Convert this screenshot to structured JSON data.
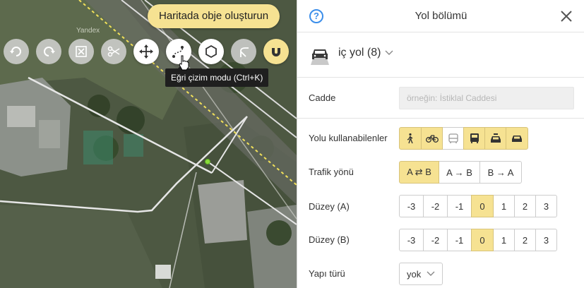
{
  "map": {
    "create_button": "Haritada obje oluşturun",
    "watermark": "Yandex",
    "tooltip": "Eğri çizim modu (Ctrl+K)",
    "tools": [
      {
        "name": "undo-icon",
        "state": "disabled"
      },
      {
        "name": "redo-icon",
        "state": "disabled"
      },
      {
        "name": "delete-selection-icon",
        "state": "disabled"
      },
      {
        "name": "scissors-icon",
        "state": "disabled"
      },
      {
        "name": "move-icon",
        "state": "enabled"
      },
      {
        "name": "curve-draw-icon",
        "state": "enabled"
      },
      {
        "name": "polygon-icon",
        "state": "enabled"
      },
      {
        "name": "fork-icon",
        "state": "disabled"
      },
      {
        "name": "magnet-icon",
        "state": "active"
      }
    ]
  },
  "panel": {
    "title": "Yol bölümü",
    "road_type": "iç yol (8)",
    "street": {
      "label": "Cadde",
      "placeholder": "örneğin: İstiklal Caddesi",
      "value": ""
    },
    "users": {
      "label": "Yolu kullanabilenler",
      "options": [
        {
          "icon": "pedestrian-icon",
          "on": true
        },
        {
          "icon": "bicycle-icon",
          "on": true
        },
        {
          "icon": "bus-icon",
          "on": false
        },
        {
          "icon": "truck-icon",
          "on": true
        },
        {
          "icon": "taxi-icon",
          "on": true
        },
        {
          "icon": "car-icon",
          "on": true
        }
      ]
    },
    "direction": {
      "label": "Trafik yönü",
      "options": [
        "A ⇄ B",
        "A → B",
        "B → A"
      ],
      "selected": 0
    },
    "level_a": {
      "label": "Düzey (A)",
      "options": [
        "-3",
        "-2",
        "-1",
        "0",
        "1",
        "2",
        "3"
      ],
      "selected": 3
    },
    "level_b": {
      "label": "Düzey (B)",
      "options": [
        "-3",
        "-2",
        "-1",
        "0",
        "1",
        "2",
        "3"
      ],
      "selected": 3
    },
    "structure": {
      "label": "Yapı türü",
      "value": "yok"
    }
  },
  "colors": {
    "accent_yellow": "#f6e292",
    "help_blue": "#3b8eea",
    "vertex_green": "#8bdc3c"
  }
}
